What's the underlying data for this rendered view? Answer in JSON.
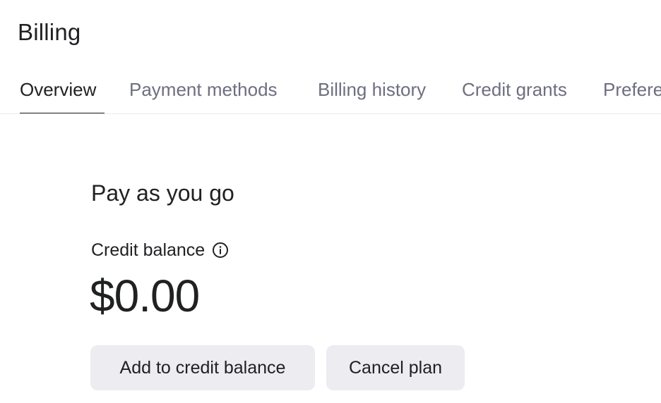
{
  "header": {
    "title": "Billing"
  },
  "tabs": [
    {
      "label": "Overview",
      "active": true
    },
    {
      "label": "Payment methods",
      "active": false
    },
    {
      "label": "Billing history",
      "active": false
    },
    {
      "label": "Credit grants",
      "active": false
    },
    {
      "label": "Preferences",
      "active": false
    }
  ],
  "plan": {
    "title": "Pay as you go",
    "balance_label": "Credit balance",
    "balance_info_icon": "info-circle-icon",
    "balance_value": "$0.00"
  },
  "actions": {
    "add_credit_label": "Add to credit balance",
    "cancel_plan_label": "Cancel plan"
  },
  "colors": {
    "text_primary": "#202123",
    "text_secondary": "#6e6e80",
    "button_bg": "#ececf1",
    "divider": "#ececf1"
  }
}
